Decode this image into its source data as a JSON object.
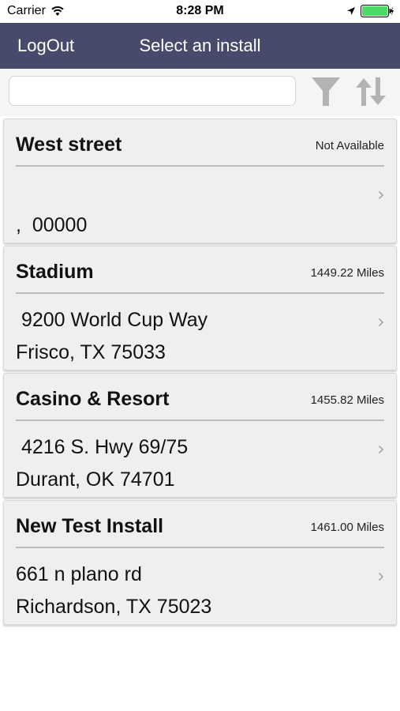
{
  "status": {
    "carrier": "Carrier",
    "time": "8:28 PM"
  },
  "nav": {
    "logout_label": "LogOut",
    "title": "Select an install"
  },
  "search": {
    "value": "",
    "placeholder": ""
  },
  "icons": {
    "filter": "filter-icon",
    "sort": "sort-icon",
    "chevron": "chevron-right-icon",
    "wifi": "wifi-icon",
    "location": "location-arrow-icon",
    "battery": "battery-charging-icon"
  },
  "colors": {
    "nav_bar": "#474a6b",
    "battery_fill": "#4cd964",
    "card_bg": "#efefef"
  },
  "installs": [
    {
      "name": "West street",
      "distance": "Not Available",
      "line1": "",
      "line2": ",  00000"
    },
    {
      "name": "Stadium",
      "distance": "1449.22 Miles",
      "line1": " 9200 World Cup Way",
      "line2": "Frisco, TX 75033"
    },
    {
      "name": "Casino & Resort",
      "distance": "1455.82 Miles",
      "line1": " 4216 S. Hwy 69/75",
      "line2": "Durant, OK 74701"
    },
    {
      "name": "New Test Install",
      "distance": "1461.00 Miles",
      "line1": "661 n plano rd",
      "line2": "Richardson, TX 75023"
    }
  ]
}
